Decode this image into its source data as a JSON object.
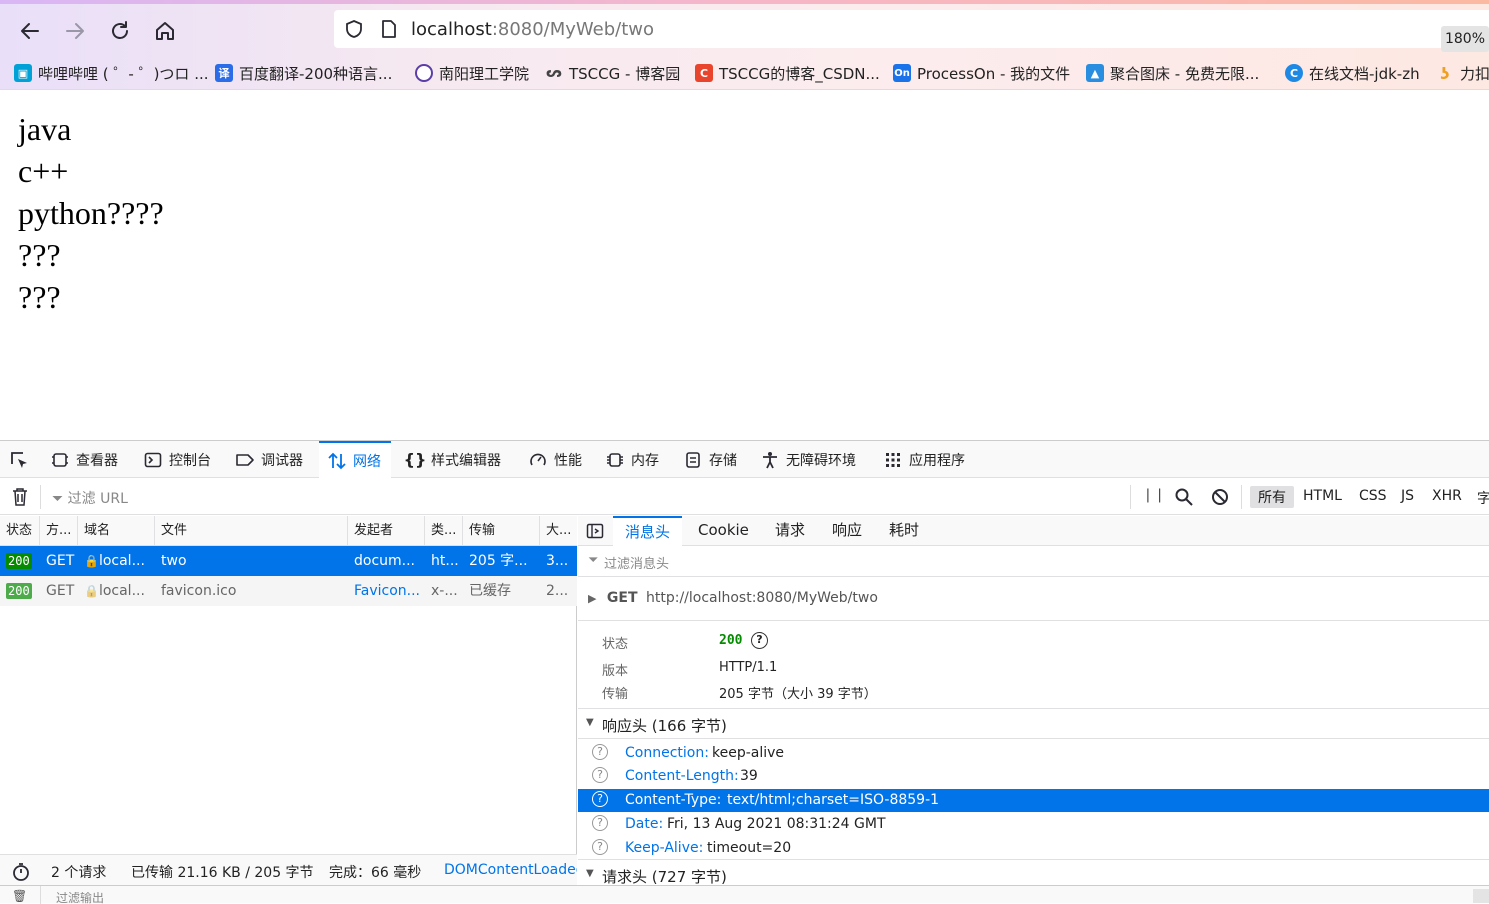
{
  "browser": {
    "url_host": "localhost",
    "url_path": ":8080/MyWeb/two",
    "zoom": "180%",
    "bookmarks": [
      {
        "label": "哔哩哔哩 ( ゜- ゜)つロ ...",
        "icon": "bilibili-icon",
        "color": "#00a1d6"
      },
      {
        "label": "百度翻译-200种语言...",
        "icon": "baidu-translate-icon",
        "color": "#2b6de8"
      },
      {
        "label": "南阳理工学院",
        "icon": "globe-icon",
        "color": "#5b3ea8"
      },
      {
        "label": "TSCCG - 博客园",
        "icon": "cnblogs-icon",
        "color": "#444444"
      },
      {
        "label": "TSCCG的博客_CSDN...",
        "icon": "csdn-icon",
        "color": "#e8452c"
      },
      {
        "label": "ProcessOn - 我的文件",
        "icon": "processon-icon",
        "color": "#1a73e8"
      },
      {
        "label": "聚合图床 - 免费无限...",
        "icon": "image-host-icon",
        "color": "#2a8ee0"
      },
      {
        "label": "在线文档-jdk-zh",
        "icon": "docs-icon",
        "color": "#1e88e5"
      },
      {
        "label": "力扣",
        "icon": "leetcode-icon",
        "color": "#f0a020"
      }
    ]
  },
  "page_content": {
    "lines": [
      "java",
      "c++",
      "python????",
      "???",
      "???"
    ]
  },
  "devtools": {
    "tabs": [
      {
        "label": "查看器",
        "icon": "inspector-icon"
      },
      {
        "label": "控制台",
        "icon": "console-icon"
      },
      {
        "label": "调试器",
        "icon": "debugger-icon"
      },
      {
        "label": "网络",
        "icon": "network-icon",
        "active": true
      },
      {
        "label": "样式编辑器",
        "icon": "style-editor-icon"
      },
      {
        "label": "性能",
        "icon": "performance-icon"
      },
      {
        "label": "内存",
        "icon": "memory-icon"
      },
      {
        "label": "存储",
        "icon": "storage-icon"
      },
      {
        "label": "无障碍环境",
        "icon": "accessibility-icon"
      },
      {
        "label": "应用程序",
        "icon": "application-icon"
      }
    ],
    "filter_url_placeholder": "过滤 URL",
    "type_filters": [
      "所有",
      "HTML",
      "CSS",
      "JS",
      "XHR",
      "字"
    ],
    "columns": [
      "状态",
      "方...",
      "域名",
      "文件",
      "发起者",
      "类...",
      "传输",
      "大..."
    ],
    "requests": [
      {
        "status": "200",
        "method": "GET",
        "domain": "local...",
        "file": "two",
        "initiator": "docum...",
        "type": "ht...",
        "transfer": "205 字...",
        "size": "3..."
      },
      {
        "status": "200",
        "method": "GET",
        "domain": "local...",
        "file": "favicon.ico",
        "initiator": "Favicon...",
        "type": "x-...",
        "transfer": "已缓存",
        "size": "2..."
      }
    ],
    "footer": {
      "requests": "2 个请求",
      "transferred": "已传输 21.16 KB / 205 字节",
      "finish": "完成：66 毫秒",
      "dcl": "DOMContentLoaded"
    },
    "detail": {
      "tabs": [
        "消息头",
        "Cookie",
        "请求",
        "响应",
        "耗时"
      ],
      "filter_placeholder": "过滤消息头",
      "request_method": "GET",
      "request_url": "http://localhost:8080/MyWeb/two",
      "status_label": "状态",
      "status_value": "200",
      "version_label": "版本",
      "version_value": "HTTP/1.1",
      "transfer_label": "传输",
      "transfer_value": "205 字节（大小 39 字节）",
      "response_headers_title": "响应头 (166 字节)",
      "response_headers": [
        {
          "key": "Connection:",
          "value": "keep-alive"
        },
        {
          "key": "Content-Length:",
          "value": "39"
        },
        {
          "key": "Content-Type:",
          "value": "text/html;charset=ISO-8859-1",
          "selected": true
        },
        {
          "key": "Date:",
          "value": "Fri, 13 Aug 2021 08:31:24 GMT"
        },
        {
          "key": "Keep-Alive:",
          "value": "timeout=20"
        }
      ],
      "request_headers_title": "请求头 (727 字节)"
    },
    "console_filter_placeholder": "过滤输出"
  },
  "colors": {
    "accent": "#0074e8",
    "status_ok": "#058b00"
  }
}
